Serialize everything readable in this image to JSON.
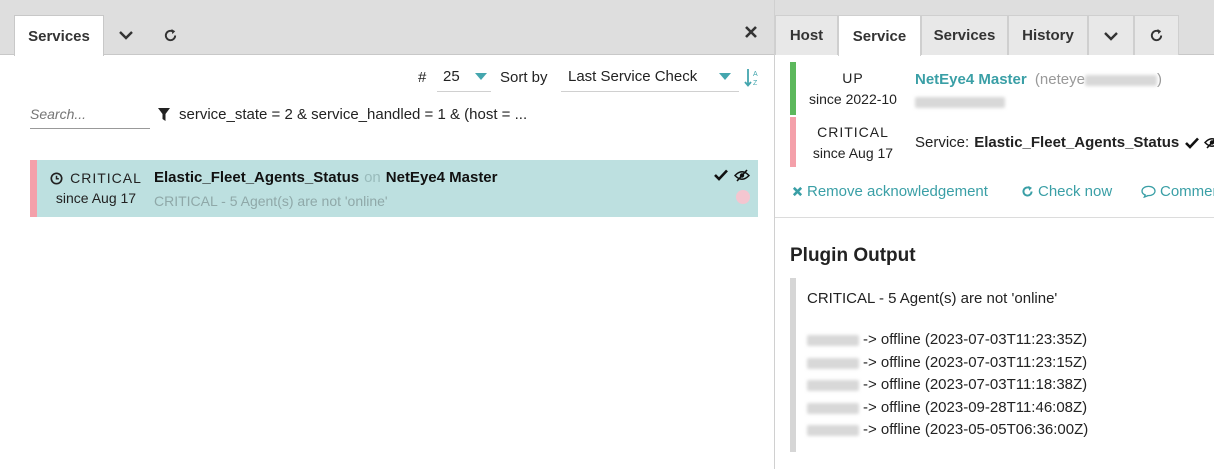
{
  "left": {
    "tabs": [
      {
        "label": "Services",
        "active": true
      }
    ],
    "controls": {
      "limit_label": "#",
      "limit_value": "25",
      "sort_label": "Sort by",
      "sort_value": "Last Service Check"
    },
    "search_placeholder": "Search...",
    "filter_text": "service_state = 2 & service_handled = 1 & (host = ...",
    "rows": [
      {
        "state": "CRITICAL",
        "since": "since Aug 17",
        "service": "Elastic_Fleet_Agents_Status",
        "on": "on",
        "host": "NetEye4 Master",
        "output": "CRITICAL - 5 Agent(s) are not 'online'"
      }
    ]
  },
  "right": {
    "tabs": [
      {
        "label": "Host",
        "active": false
      },
      {
        "label": "Service",
        "active": true
      },
      {
        "label": "Services",
        "active": false
      },
      {
        "label": "History",
        "active": false
      }
    ],
    "host": {
      "state": "UP",
      "since": "since 2022-10",
      "name": "NetEye4 Master",
      "fqdn_prefix": "(neteye",
      "fqdn_suffix": ")"
    },
    "service": {
      "state": "CRITICAL",
      "since": "since Aug 17",
      "label": "Service:",
      "name": "Elastic_Fleet_Agents_Status"
    },
    "actions": {
      "remove_ack": "Remove acknowledgement",
      "check_now": "Check now",
      "comment": "Commen"
    },
    "plugin": {
      "title": "Plugin Output",
      "summary": "CRITICAL - 5 Agent(s) are not 'online'",
      "lines": [
        "-> offline (2023-07-03T11:23:35Z)",
        "-> offline (2023-07-03T11:23:15Z)",
        "-> offline (2023-07-03T11:18:38Z)",
        "-> offline (2023-09-28T11:46:08Z)",
        "-> offline (2023-05-05T06:36:00Z)"
      ]
    }
  },
  "colors": {
    "accent": "#44a6ae",
    "critical": "#f4a0aa",
    "ok": "#5cb85c",
    "row_highlight": "#bde0e0"
  }
}
